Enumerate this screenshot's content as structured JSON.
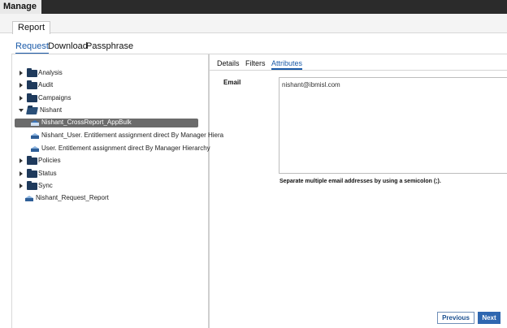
{
  "header": {
    "title": "Manage"
  },
  "report_tab": {
    "label": "Report"
  },
  "subtabs": [
    {
      "label": "Request",
      "active": true
    },
    {
      "label": "Download",
      "active": false
    },
    {
      "label": "Passphrase",
      "active": false
    }
  ],
  "tree": {
    "items": [
      {
        "label": "Analysis",
        "type": "folder",
        "expanded": false
      },
      {
        "label": "Audit",
        "type": "folder",
        "expanded": false
      },
      {
        "label": "Campaigns",
        "type": "folder",
        "expanded": false
      },
      {
        "label": "Nishant",
        "type": "folder",
        "expanded": true
      },
      {
        "label": "Nishant_CrossReport_AppBulk",
        "type": "report",
        "selected": true
      },
      {
        "label": "Nishant_User. Entitlement assignment direct By Manager Hiera",
        "type": "report"
      },
      {
        "label": "User. Entitlement assignment direct By Manager Hierarchy",
        "type": "report"
      },
      {
        "label": "Policies",
        "type": "folder",
        "expanded": false
      },
      {
        "label": "Status",
        "type": "folder",
        "expanded": false
      },
      {
        "label": "Sync",
        "type": "folder",
        "expanded": false
      },
      {
        "label": "Nishant_Request_Report",
        "type": "report"
      }
    ]
  },
  "detail_tabs": [
    {
      "label": "Details",
      "active": false
    },
    {
      "label": "Filters",
      "active": false
    },
    {
      "label": "Attributes",
      "active": true
    }
  ],
  "attributes": {
    "email_label": "Email",
    "email_value": "nishant@ibmisl.com",
    "email_hint": "Separate multiple email addresses by using a semicolon (;)."
  },
  "buttons": {
    "previous": "Previous",
    "next": "Next"
  },
  "colors": {
    "accent": "#1a5aa8",
    "topbar": "#2b2b2b",
    "selected_row": "#6b6b6b",
    "folder": "#1f3a5c",
    "next_button": "#2f67b0"
  }
}
